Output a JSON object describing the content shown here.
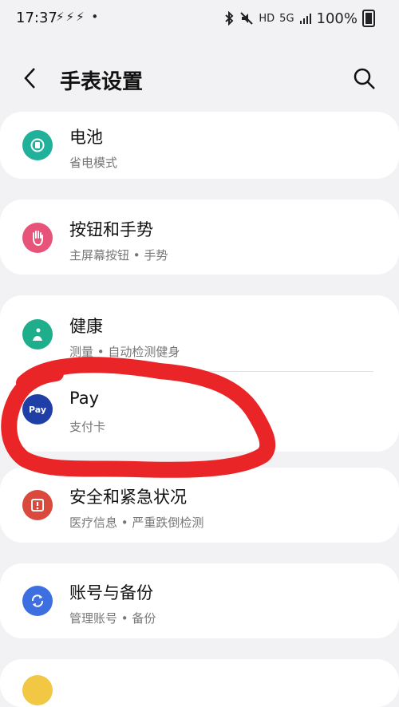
{
  "status_bar": {
    "time": "17:37",
    "notif_icons": "⚡⚡⚡ •",
    "hd": "HD",
    "net": "5G",
    "battery_pct": "100%"
  },
  "header": {
    "title": "手表设置"
  },
  "items": [
    {
      "title": "电池",
      "subtitle": "省电模式",
      "icon": "battery-icon",
      "color": "#21b09a"
    },
    {
      "title": "按钮和手势",
      "subtitle": "主屏幕按钮 • 手势",
      "icon": "hand-icon",
      "color": "#e8537a"
    },
    {
      "title": "健康",
      "subtitle": "测量 • 自动检测健身",
      "icon": "health-icon",
      "color": "#1fae8b"
    },
    {
      "title": "Pay",
      "subtitle": "支付卡",
      "icon": "pay-icon",
      "color": "#1f3fa6",
      "icon_text": "Pay"
    },
    {
      "title": "安全和紧急状况",
      "subtitle": "医疗信息 • 严重跌倒检测",
      "icon": "alert-icon",
      "color": "#d9493c"
    },
    {
      "title": "账号与备份",
      "subtitle": "管理账号 • 备份",
      "icon": "sync-icon",
      "color": "#3d6fe0"
    },
    {
      "title": "",
      "subtitle": "",
      "icon": "partial-icon",
      "color": "#f2c744"
    }
  ],
  "annotation": {
    "color": "#e8191b"
  }
}
